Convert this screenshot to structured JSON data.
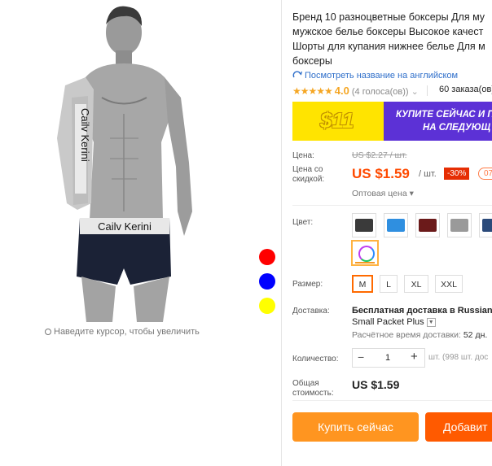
{
  "product": {
    "title_lines": [
      "Бренд 10 разноцветные боксеры Для му",
      "мужское белье боксеры Высокое качест",
      "Шорты для купания нижнее белье Для м",
      "боксеры"
    ],
    "translate_link": "Посмотреть название на английском",
    "rating_stars": "★★★★★",
    "rating_value": "4.0",
    "votes": "(4 голоса(ов))",
    "orders": "60 заказа(ов)",
    "waistband_text": "Cailv Kerini"
  },
  "gallery": {
    "zoom_hint": "Наведите курсор, чтобы увеличить",
    "dot_colors": [
      "#ff0000",
      "#0000ff",
      "#ffff00"
    ]
  },
  "banner": {
    "coupon": "$11",
    "line1": "КУПИТЕ СЕЙЧАС И П",
    "line2": "НА СЛЕДУЮЩ"
  },
  "price": {
    "label": "Цена:",
    "old": "US $2.27 / шт.",
    "discount_label_1": "Цена со",
    "discount_label_2": "скидкой:",
    "current": "US $1.59",
    "unit": "/ шт.",
    "discount": "-30%",
    "extra_badge": "07",
    "wholesale": "Оптовая цена ▾"
  },
  "color": {
    "label": "Цвет:",
    "swatches": [
      "#3a3a3a",
      "#2f8fe0",
      "#6b1a1a",
      "#9a9a9a",
      "#2b4a7a"
    ]
  },
  "size": {
    "label": "Размер:",
    "options": [
      "M",
      "L",
      "XL",
      "XXL"
    ],
    "selected": "M"
  },
  "shipping": {
    "label": "Доставка:",
    "line1": "Бесплатная доставка в Russian F",
    "line2": "Small Packet Plus",
    "estimate_label": "Расчётное время доставки:",
    "estimate_value": "52 дн."
  },
  "quantity": {
    "label": "Количество:",
    "minus": "−",
    "value": "1",
    "plus": "+",
    "available": "шт. (998 шт. дос"
  },
  "total": {
    "label_1": "Общая",
    "label_2": "стоимость:",
    "value": "US $1.59"
  },
  "actions": {
    "buy": "Купить сейчас",
    "add": "Добавит"
  }
}
